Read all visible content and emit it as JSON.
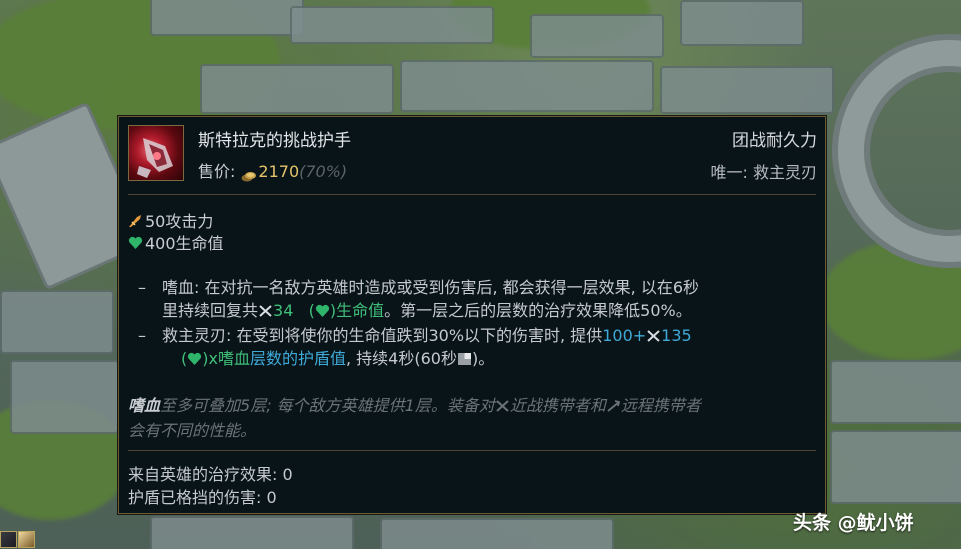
{
  "item": {
    "name": "斯特拉克的挑战护手",
    "category": "团战耐久力",
    "price_label": "售价:",
    "price_value": "2170",
    "price_percent": "(70%)",
    "unique": "唯一: 救主灵刃"
  },
  "stats": [
    {
      "icon": "attack-damage-icon",
      "text": "50攻击力"
    },
    {
      "icon": "health-heart-icon",
      "text": "400生命值"
    }
  ],
  "passives": {
    "bloodlust": {
      "dash": "–",
      "line1": "嗜血: 在对抗一名敌方英雄时造成或受到伤害后, 都会获得一层效果, 以在6秒",
      "line2_a": "里持续回复共",
      "line2_val": "34",
      "line2_b": "(",
      "line2_c": ")生命值",
      "line2_d": "。第一层之后的层数的治疗效果降低50%。"
    },
    "lifeline": {
      "dash": "–",
      "line1_a": "救主灵刃: 在受到将使你的生命值跌到30%以下的伤害时, 提供",
      "line1_val": "100+",
      "line1_val2": "135",
      "line2_a": "(",
      "line2_b": ")x嗜血",
      "line2_c": "层数的护盾值",
      "line2_d": ", 持续4秒(60秒",
      "line2_e": ")。"
    }
  },
  "note": {
    "key": "嗜血",
    "line1_a": "至多可叠加5层; 每个敌方英雄提供1层。装备对",
    "line1_b": "近战携带者和",
    "line1_c": "远程携带者",
    "line2": "会有不同的性能。"
  },
  "footer": {
    "healing": "来自英雄的治疗效果: 0",
    "shielded": "护盾已格挡的伤害: 0"
  },
  "watermark": "头条 @鱿小饼",
  "colors": {
    "gold": "#e7c36a",
    "health_green": "#3fbf7a",
    "scaling_blue": "#3fa9d8",
    "border": "#6a5a33",
    "panel_bg": "#091418"
  }
}
